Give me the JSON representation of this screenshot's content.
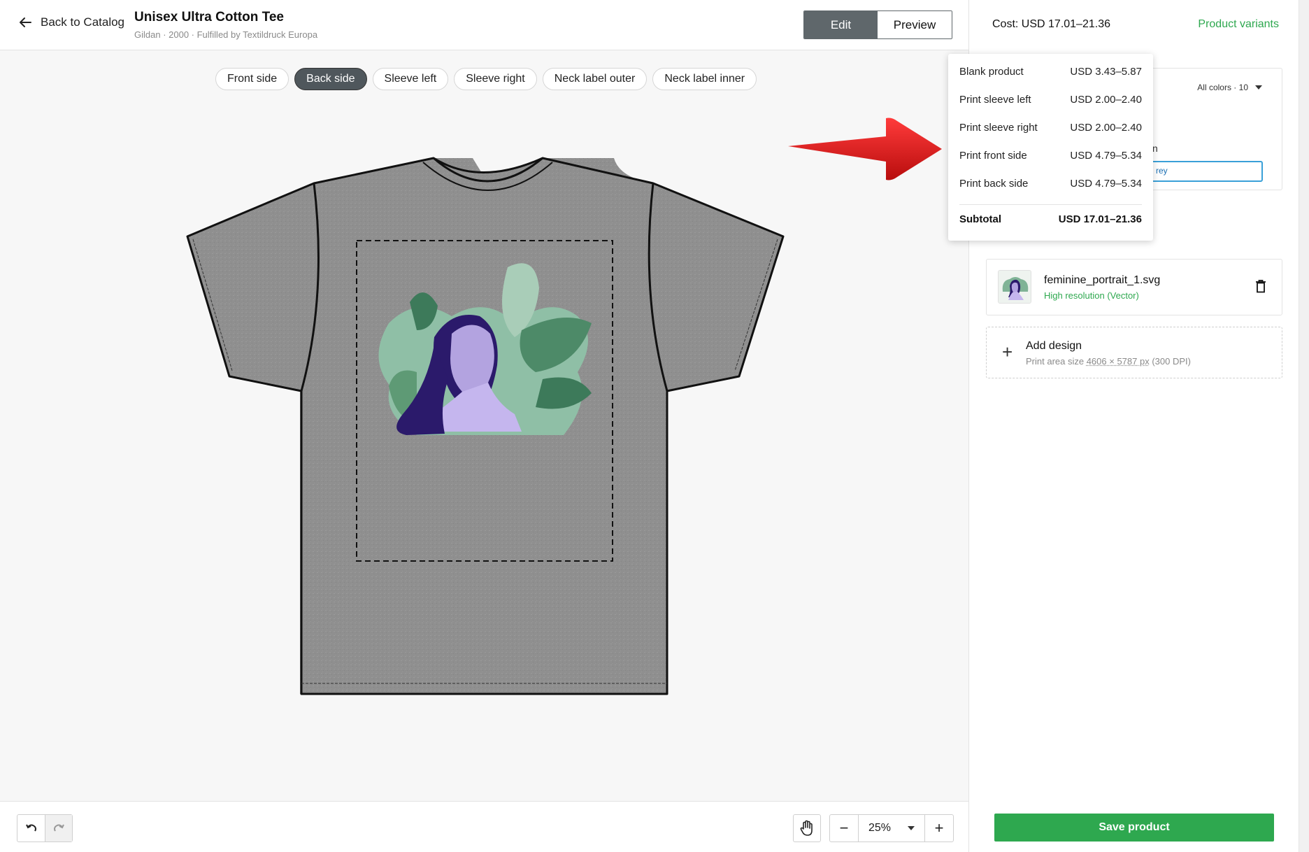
{
  "header": {
    "back_label": "Back to Catalog",
    "product_title": "Unisex Ultra Cotton Tee",
    "product_subtitle": "Gildan · 2000 · Fulfilled by Textildruck Europa",
    "mode_edit": "Edit",
    "mode_preview": "Preview",
    "active_mode": "Edit"
  },
  "side_tabs": [
    "Front side",
    "Back side",
    "Sleeve left",
    "Sleeve right",
    "Neck label outer",
    "Neck label inner"
  ],
  "active_side_tab": "Back side",
  "canvas": {
    "shirt_color": "#8e8e8e",
    "design_name": "feminine portrait illustration"
  },
  "toolbar": {
    "undo_icon": "undo-icon",
    "redo_icon": "redo-icon",
    "hand_icon": "hand-icon",
    "zoom_out": "−",
    "zoom_value": "25%",
    "zoom_in": "+"
  },
  "panel": {
    "cost_label": "Cost: USD 17.01–21.36",
    "variants_link": "Product variants",
    "colors_select": "All colors · 10",
    "partial_label": "n",
    "partial_input_value": "rey",
    "design": {
      "file_name": "feminine_portrait_1.svg",
      "resolution": "High resolution (Vector)"
    },
    "add_design": {
      "title": "Add design",
      "sub_prefix": "Print area size ",
      "sub_size": "4606 × 5787 px",
      "sub_dpi": " (300 DPI)"
    },
    "save_label": "Save product"
  },
  "cost_breakdown": {
    "rows": [
      {
        "label": "Blank product",
        "value": "USD 3.43–5.87"
      },
      {
        "label": "Print sleeve left",
        "value": "USD 2.00–2.40"
      },
      {
        "label": "Print sleeve right",
        "value": "USD 2.00–2.40"
      },
      {
        "label": "Print front side",
        "value": "USD 4.79–5.34"
      },
      {
        "label": "Print back side",
        "value": "USD 4.79–5.34"
      }
    ],
    "subtotal_label": "Subtotal",
    "subtotal_value": "USD 17.01–21.36"
  },
  "colors": {
    "accent_green": "#2ea84f",
    "toggle_dark": "#5f676b",
    "annotation_red": "#e01b1b"
  }
}
